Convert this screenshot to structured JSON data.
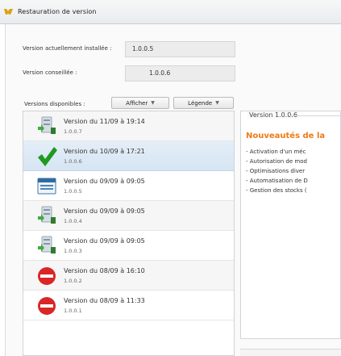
{
  "window": {
    "title": "Restauration de version"
  },
  "fields": {
    "installed": {
      "label": "Version actuellement installée :",
      "value": "1.0.0.5"
    },
    "advised": {
      "label": "Version conseillée :",
      "value": "1.0.0.6"
    }
  },
  "toolbar": {
    "label": "Versions disponibles :",
    "show_button": "Afficher",
    "legend_button": "Légende"
  },
  "versions": [
    {
      "title": "Version du 11/09 à 19:14",
      "version": "1.0.0.7",
      "icon": "server-download-icon"
    },
    {
      "title": "Version du 10/09 à 17:21",
      "version": "1.0.0.6",
      "icon": "checkmark-icon"
    },
    {
      "title": "Version du 09/09 à 09:05",
      "version": "1.0.0.5",
      "icon": "window-icon"
    },
    {
      "title": "Version du 09/09 à 09:05",
      "version": "1.0.0.4",
      "icon": "server-download-icon"
    },
    {
      "title": "Version du 09/09 à 09:05",
      "version": "1.0.0.3",
      "icon": "server-download-icon"
    },
    {
      "title": "Version du 08/09 à 16:10",
      "version": "1.0.0.2",
      "icon": "no-entry-icon"
    },
    {
      "title": "Version du 08/09 à 11:33",
      "version": "1.0.0.1",
      "icon": "no-entry-icon"
    }
  ],
  "details": {
    "legend": "Version 1.0.0.6",
    "news_title": "Nouveautés de la",
    "items": [
      "- Activation d'un méc",
      "- Autorisation de mod",
      "- Optimisations diver",
      "- Automatisation de D",
      "- Gestion des stocks ("
    ]
  },
  "colors": {
    "accent_orange": "#f07a13",
    "selected_row": "#d9e7f5",
    "check_green": "#1f9a20",
    "stop_red": "#d92626"
  }
}
